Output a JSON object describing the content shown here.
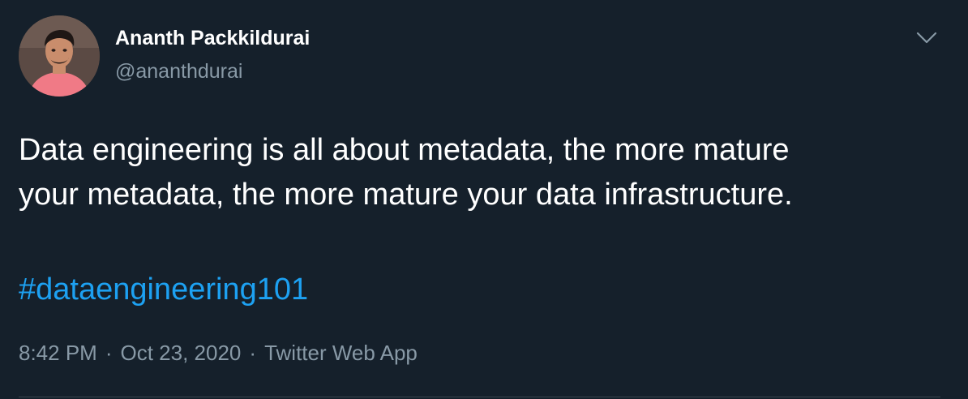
{
  "author": {
    "display_name": "Ananth Packkildurai",
    "handle": "@ananthdurai",
    "avatar_icon": "profile-photo"
  },
  "tweet": {
    "text_lines": [
      "Data engineering is all about metadata, the more mature",
      "your metadata, the more mature your data infrastructure."
    ],
    "hashtag": "#dataengineering101",
    "time": "8:42 PM",
    "date": "Oct 23, 2020",
    "source": "Twitter Web App",
    "separator": "·"
  },
  "icons": {
    "caret": "chevron-down-icon"
  },
  "colors": {
    "background": "#15202b",
    "primary_text": "#ffffff",
    "secondary_text": "#8899a6",
    "link": "#1da1f2",
    "divider": "#38444d"
  }
}
